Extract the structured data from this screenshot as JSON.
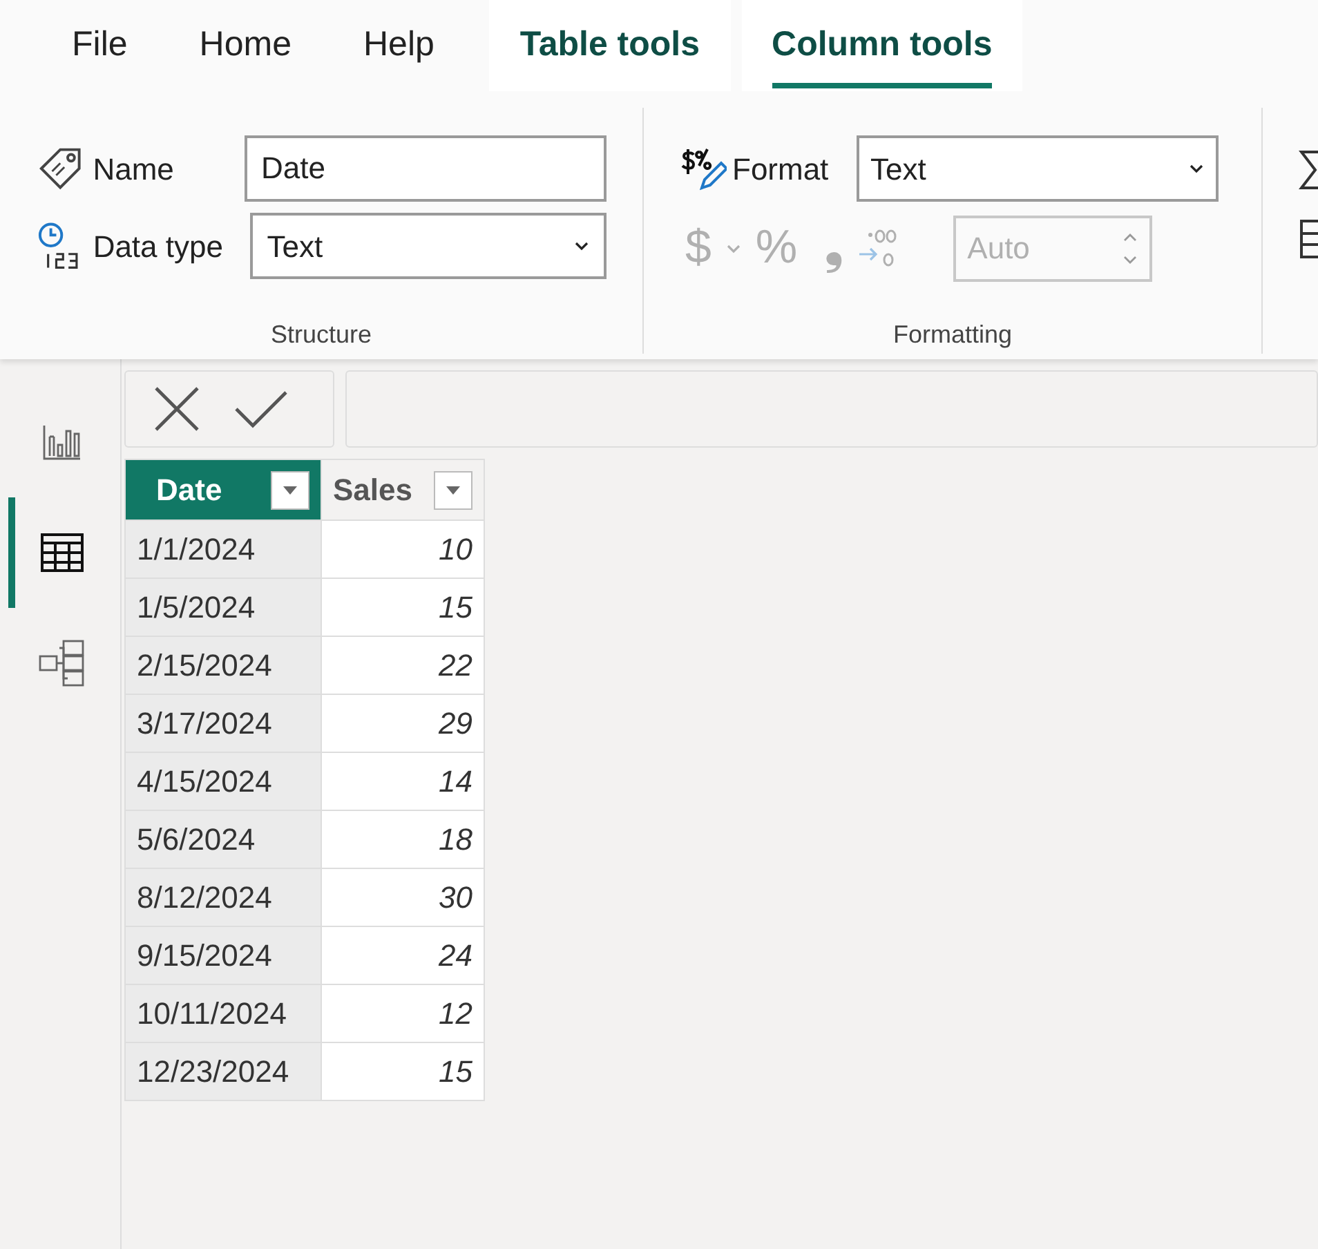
{
  "tabs": [
    {
      "label": "File",
      "kind": "standard",
      "selected": false
    },
    {
      "label": "Home",
      "kind": "standard",
      "selected": false
    },
    {
      "label": "Help",
      "kind": "standard",
      "selected": false
    },
    {
      "label": "Table tools",
      "kind": "contextual",
      "selected": false
    },
    {
      "label": "Column tools",
      "kind": "contextual",
      "selected": true
    }
  ],
  "ribbon": {
    "structure": {
      "name_label": "Name",
      "name_value": "Date",
      "data_type_label": "Data type",
      "data_type_value": "Text",
      "group_label": "Structure"
    },
    "formatting": {
      "format_label": "Format",
      "format_value": "Text",
      "currency_symbol": "$",
      "percent_symbol": "%",
      "comma_symbol": "❟",
      "decimals_placeholder": "Auto",
      "disabled": true,
      "group_label": "Formatting"
    }
  },
  "side_rail": [
    {
      "kind": "report",
      "selected": false
    },
    {
      "kind": "table",
      "selected": true
    },
    {
      "kind": "model",
      "selected": false
    }
  ],
  "table": {
    "columns": [
      {
        "label": "Date",
        "selected": true,
        "kind": "text"
      },
      {
        "label": "Sales",
        "selected": false,
        "kind": "number"
      }
    ],
    "rows": [
      [
        "1/1/2024",
        "10"
      ],
      [
        "1/5/2024",
        "15"
      ],
      [
        "2/15/2024",
        "22"
      ],
      [
        "3/17/2024",
        "29"
      ],
      [
        "4/15/2024",
        "14"
      ],
      [
        "5/6/2024",
        "18"
      ],
      [
        "8/12/2024",
        "30"
      ],
      [
        "9/15/2024",
        "24"
      ],
      [
        "10/11/2024",
        "12"
      ],
      [
        "12/23/2024",
        "15"
      ]
    ]
  }
}
